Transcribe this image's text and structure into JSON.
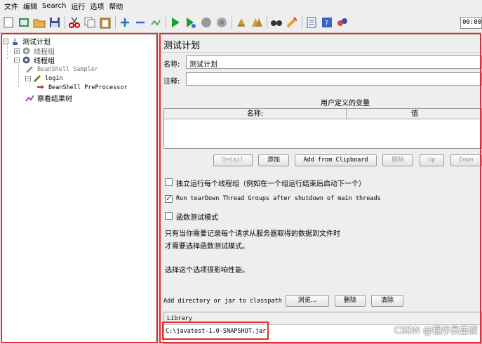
{
  "menu": [
    "文件",
    "编辑",
    "Search",
    "运行",
    "选项",
    "帮助"
  ],
  "toolbar": {
    "icons": [
      "new-icon",
      "templates-icon",
      "open-icon",
      "save-icon",
      "cut-icon",
      "copy-icon",
      "paste-icon",
      "expand-icon",
      "collapse-icon",
      "toggle-icon",
      "start-icon",
      "start-no-pause-icon",
      "stop-icon",
      "shutdown-icon",
      "clear-icon",
      "clear-all-icon",
      "search-icon",
      "reset-search-icon",
      "function-helper-icon",
      "help-icon",
      "remote-icon"
    ],
    "timer": "00:00"
  },
  "tree": {
    "test_plan": "测试计划",
    "thread_group_1": "线程组",
    "thread_group_2": "线程组",
    "beanshell_sampler": "BeanShell Sampler",
    "login": "login",
    "beanshell_preprocessor": "BeanShell PreProcessor",
    "results_tree": "察看结果树"
  },
  "panel": {
    "title": "测试计划",
    "name_label": "名称:",
    "name_value": "测试计划",
    "comment_label": "注释:",
    "comment_value": "",
    "vars_title": "用户定义的变量",
    "col_name": "名称:",
    "col_value": "值",
    "buttons": {
      "detail": "Detail",
      "add": "添加",
      "add_clipboard": "Add from Clipboard",
      "delete": "删除",
      "up": "Up",
      "down": "Down"
    },
    "checkbox_serialize": {
      "label": "独立运行每个线程组（例如在一个组运行结束后启动下一个）",
      "checked": false
    },
    "checkbox_teardown": {
      "label": "Run tearDown Thread Groups after shutdown of main threads",
      "checked": true
    },
    "checkbox_functional": {
      "label": "函数测试模式",
      "checked": false
    },
    "note_line1": "只有当你需要记录每个请求从服务器取得的数据到文件时",
    "note_line2": "才需要选择函数测试模式。",
    "note_line3": "选择这个选项很影响性能。",
    "classpath_label": "Add directory or jar to classpath",
    "browse": "浏览...",
    "cp_delete": "删除",
    "cp_clear": "清除",
    "library_header": "Library",
    "library_entry": "C:\\javatest-1.0-SNAPSHOT.jar"
  },
  "watermark": "CSDN @程序员雷叔",
  "colors": {
    "annotation_red": "#e03030",
    "panel_bg": "#eeeeee"
  }
}
